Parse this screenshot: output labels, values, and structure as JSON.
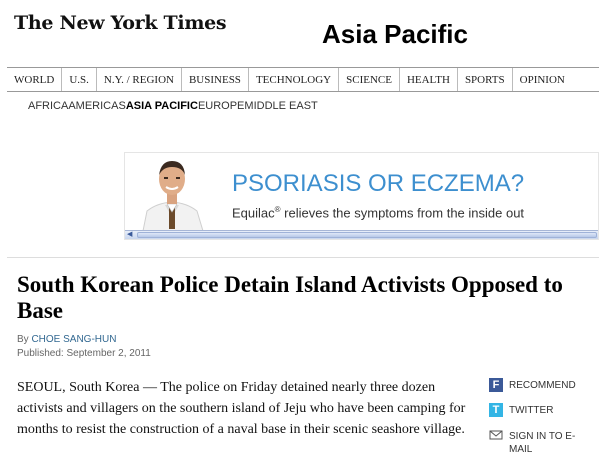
{
  "masthead": {
    "logo_text": "The New York Times",
    "section_title": "Asia Pacific"
  },
  "nav": {
    "items": [
      {
        "label": "WORLD"
      },
      {
        "label": "U.S."
      },
      {
        "label": "N.Y. / REGION"
      },
      {
        "label": "BUSINESS"
      },
      {
        "label": "TECHNOLOGY"
      },
      {
        "label": "SCIENCE"
      },
      {
        "label": "HEALTH"
      },
      {
        "label": "SPORTS"
      },
      {
        "label": "OPINION"
      }
    ]
  },
  "subnav": {
    "items": [
      {
        "label": "AFRICA"
      },
      {
        "label": "AMERICAS"
      },
      {
        "label": "ASIA PACIFIC"
      },
      {
        "label": "EUROPE"
      },
      {
        "label": "MIDDLE EAST"
      }
    ],
    "active": "ASIA PACIFIC"
  },
  "ad": {
    "headline": "PSORIASIS OR ECZEMA?",
    "brand": "Equilac",
    "trademark": "®",
    "tagline": " relieves the symptoms from the inside out",
    "headline_color": "#3d8fcf"
  },
  "article": {
    "headline": "South Korean Police Detain Island Activists Opposed to Base",
    "byline_prefix": "By ",
    "author": "CHOE SANG-HUN",
    "published": "Published: September 2, 2011",
    "lead": "SEOUL, South Korea — The police on Friday detained nearly three dozen activists and villagers on the southern island of Jeju who have been camping for months to resist the construction of a naval base in their scenic seashore village."
  },
  "share_tools": {
    "recommend_label": "RECOMMEND",
    "twitter_label": "TWITTER",
    "email_label": "SIGN IN TO E-MAIL",
    "facebook_icon_glyph": "f",
    "twitter_icon_glyph": "t",
    "facebook_color": "#3b5998",
    "twitter_color": "#33b5e5"
  },
  "colors": {
    "link": "#326891",
    "nav_border": "#999999"
  }
}
